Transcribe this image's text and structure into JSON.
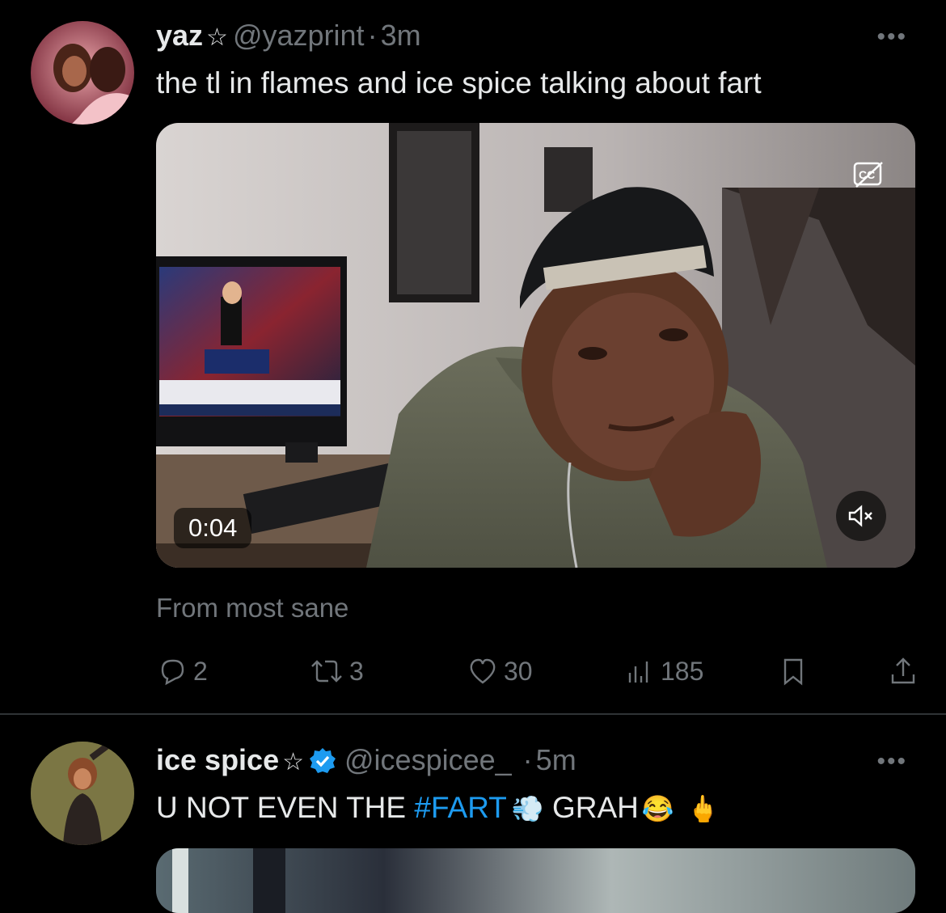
{
  "tweet1": {
    "author": "yaz",
    "handle": "@yazprint",
    "separator": "·",
    "time": "3m",
    "text": "the tl in flames and ice spice talking about fart",
    "video_time": "0:04",
    "caption": "From most sane",
    "replies": "2",
    "retweets": "3",
    "likes": "30",
    "views": "185",
    "more_icon": "more-dots-icon",
    "cc_icon": "closed-captions-icon",
    "mute_icon": "mute-icon"
  },
  "tweet2": {
    "author": "ice spice",
    "handle": "@icespicee_",
    "separator": "·",
    "time": "5m",
    "text_before": "U NOT EVEN THE ",
    "hashtag": "#FART",
    "emoji1": "💨",
    "text_mid": " GRAH",
    "emoji2": "😂",
    "emoji3": "🖕",
    "verified_color": "#1d9bf0"
  },
  "colors": {
    "background": "#000000",
    "text": "#e7e9ea",
    "muted": "#71767b",
    "accent": "#1d9bf0",
    "divider": "#2f3336"
  }
}
